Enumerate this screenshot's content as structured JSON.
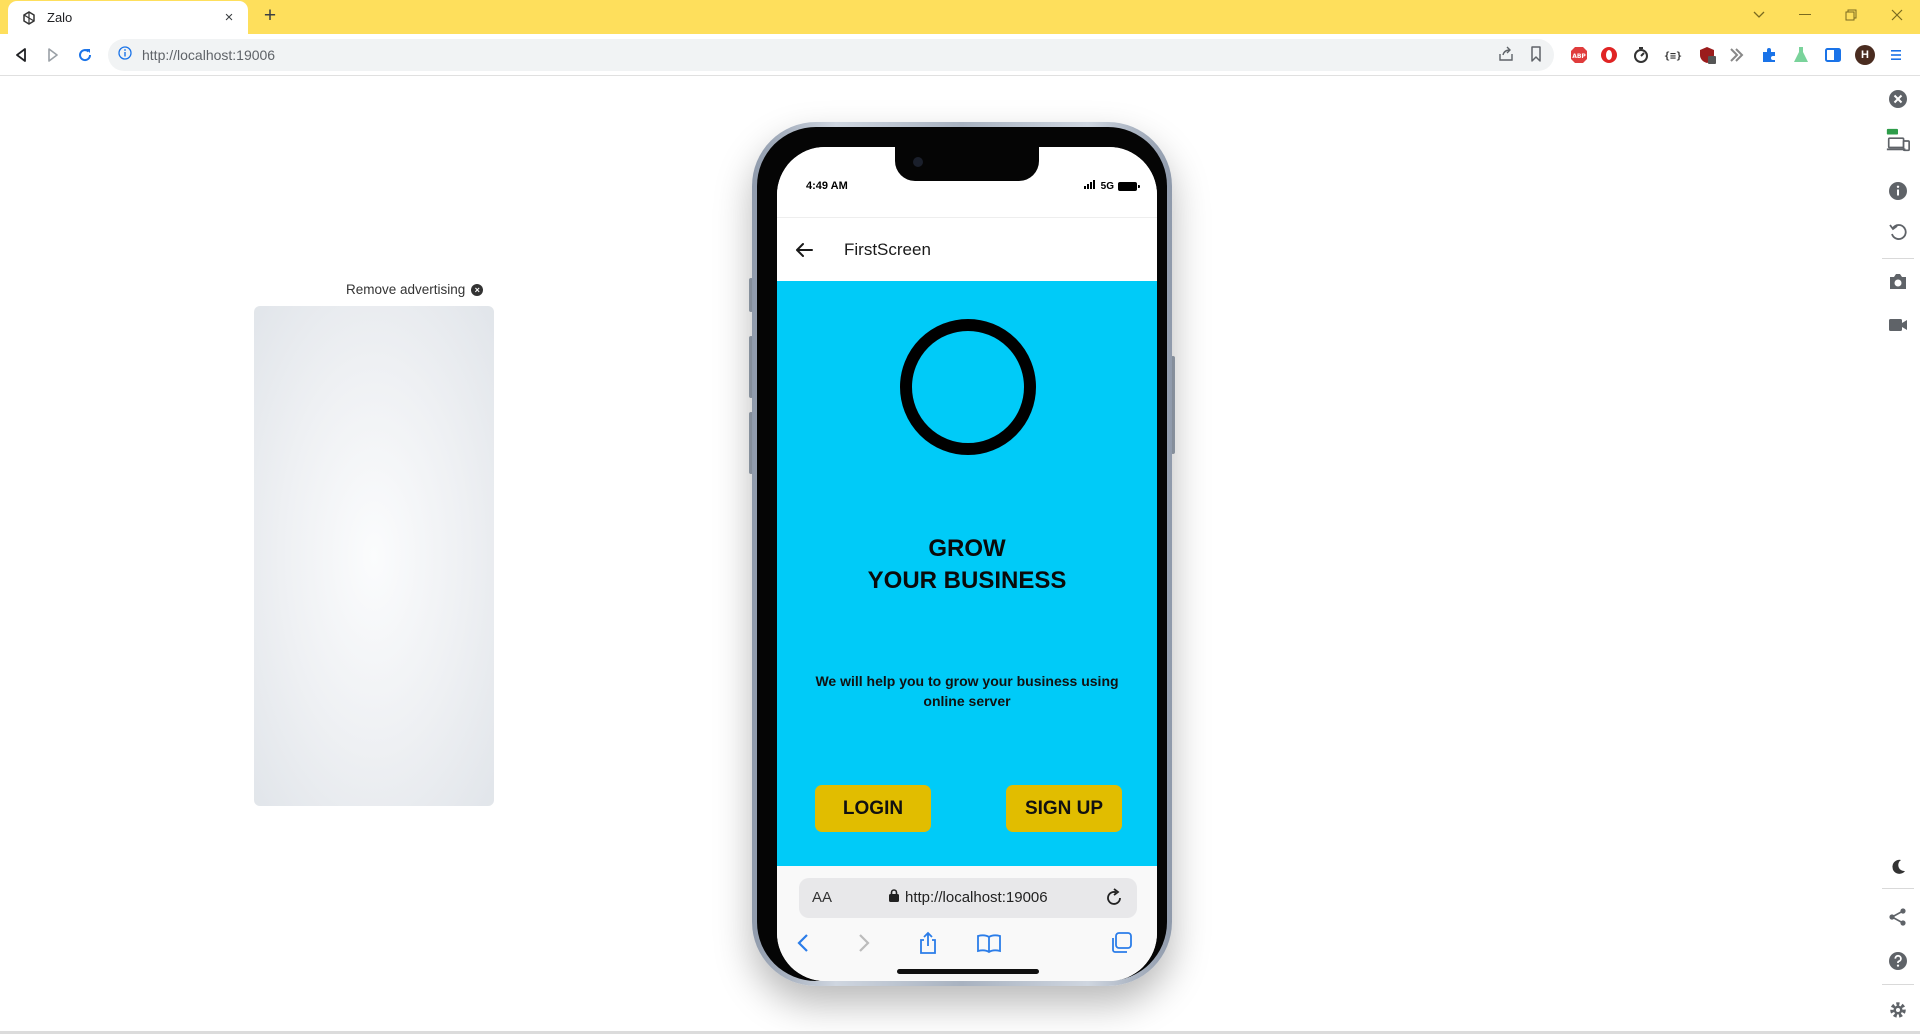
{
  "browser": {
    "tab_title": "Zalo",
    "tab_close": "×",
    "new_tab": "+",
    "url": "http://localhost:19006",
    "profile_initial": "H"
  },
  "page": {
    "ad": {
      "remove_label": "Remove advertising"
    }
  },
  "phone": {
    "status": {
      "time": "4:49 AM",
      "network": "5G"
    },
    "header": {
      "title": "FirstScreen"
    },
    "content": {
      "headline_line1": "GROW",
      "headline_line2": "YOUR BUSINESS",
      "subtext": "We will help you to grow your business using online server",
      "login_label": "LOGIN",
      "signup_label": "SIGN UP"
    },
    "safari": {
      "aa_label": "AA",
      "url": "http://localhost:19006"
    }
  },
  "colors": {
    "tabbar": "#fedf5c",
    "content_bg": "#00cbf8",
    "button_bg": "#e1bd00"
  }
}
